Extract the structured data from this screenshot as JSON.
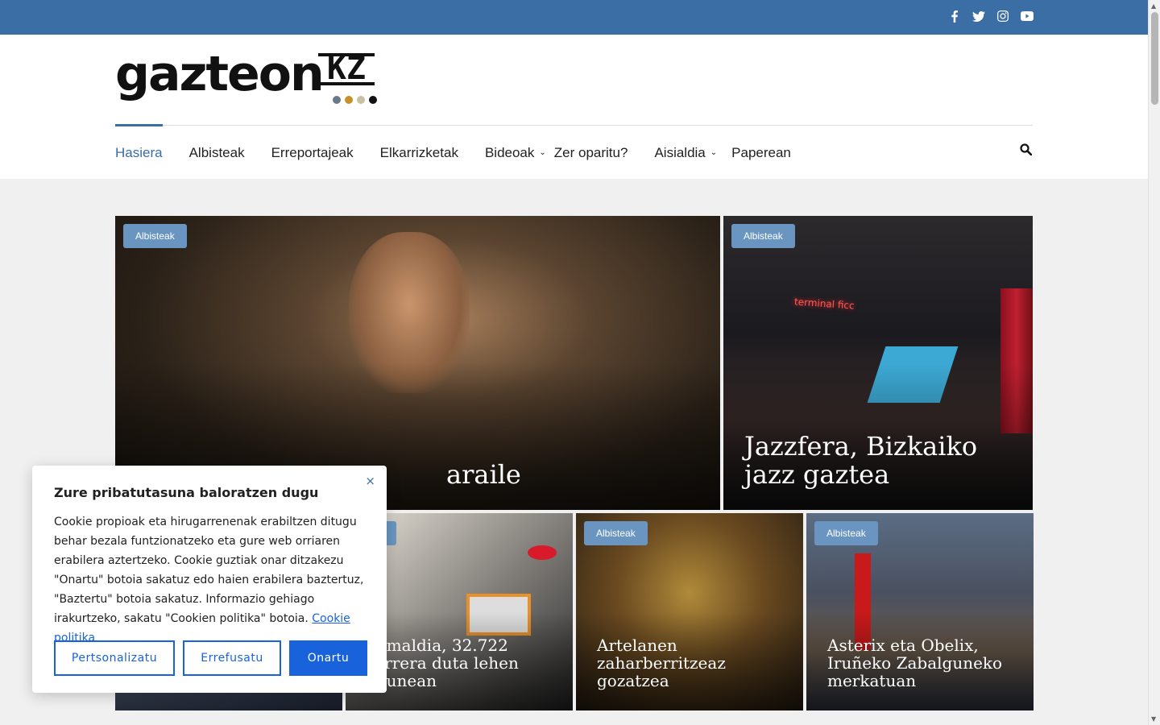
{
  "social": {
    "icons": [
      "facebook-icon",
      "twitter-icon",
      "instagram-icon",
      "youtube-icon"
    ]
  },
  "logo": {
    "text": "gazteon",
    "suffix": "KZ",
    "dot_colors": [
      "#6b7a8a",
      "#c8902a",
      "#c8c0a0",
      "#111111"
    ]
  },
  "nav": {
    "items": [
      {
        "label": "Hasiera",
        "active": true
      },
      {
        "label": "Albisteak"
      },
      {
        "label": "Erreportajeak"
      },
      {
        "label": "Elkarrizketak"
      },
      {
        "label": "Bideoak",
        "dropdown": true
      },
      {
        "label": "Zer oparitu?"
      },
      {
        "label": "Aisialdia",
        "dropdown": true
      },
      {
        "label": "Paperean"
      }
    ]
  },
  "stories": [
    {
      "tag": "Albisteak",
      "title": "araile"
    },
    {
      "tag": "Albisteak",
      "title": "Jazzfera, Bizkaiko jazz gaztea"
    },
    {
      "tag": "",
      "title": ""
    },
    {
      "tag": "teak",
      "title": "nemaldia, 32.722 sarrera duta lehen egunean"
    },
    {
      "tag": "Albisteak",
      "title": "Artelanen zaharberritzeaz gozatzea"
    },
    {
      "tag": "Albisteak",
      "title": "Asterix eta Obelix, Iruñeko Zabalguneko merkatuan"
    }
  ],
  "cookie": {
    "title": "Zure pribatutasuna baloratzen dugu",
    "body": "Cookie propioak eta hirugarrenenak erabiltzen ditugu behar bezala funtzionatzeko eta gure web orriaren erabilera aztertzeko. Cookie guztiak onar ditzakezu \"Onartu\" botoia sakatuz edo haien erabilera baztertuz, \"Baztertu\" botoia sakatuz. Informazio gehiago irakurtzeko, sakatu \"Cookien politika\" botoia.",
    "link": "Cookie politika",
    "buttons": {
      "customize": "Pertsonalizatu",
      "reject": "Errefusatu",
      "accept": "Onartu"
    },
    "close": "×"
  }
}
